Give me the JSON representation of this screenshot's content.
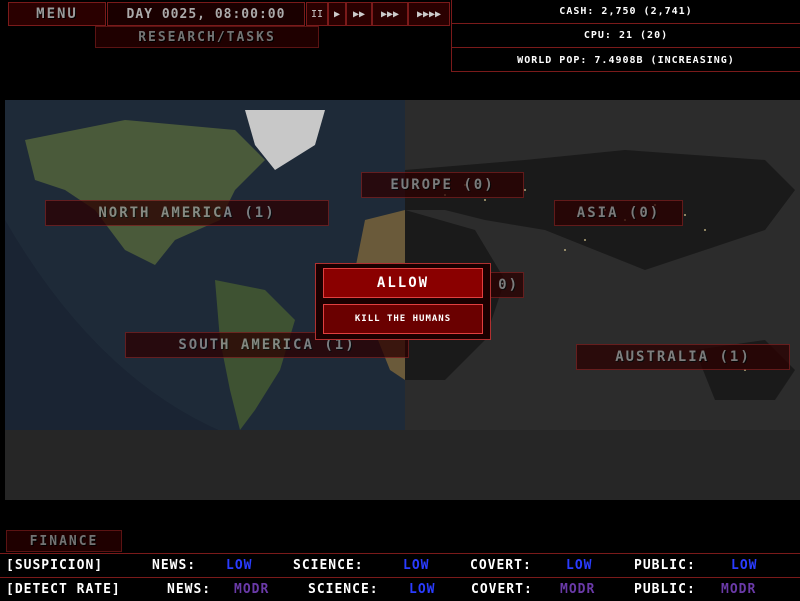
{
  "topbar": {
    "menu_label": "Menu",
    "day_text": "DAY 0025, 08:00:00",
    "speed_buttons": [
      "II",
      "▶",
      "▶▶",
      "▶▶▶",
      "▶▶▶▶"
    ],
    "research_label": "Research/Tasks"
  },
  "stats": {
    "cash": "CASH: 2,750 (2,741)",
    "cpu": "CPU: 21 (20)",
    "world_pop": "WORLD POP: 7.4908B (INCREASING)"
  },
  "regions": {
    "north_america": "NORTH AMERICA (1)",
    "south_america": "SOUTH AMERICA (1)",
    "europe": "EUROPE (0)",
    "asia": "ASIA (0)",
    "australia": "AUSTRALIA (1)",
    "africa_partial": "0)"
  },
  "dialog": {
    "allow_label": "Allow",
    "kill_label": "Kill the humans"
  },
  "finance_label": "Finance",
  "suspicion": {
    "label": "[SUSPICION]",
    "news_label": "NEWS:",
    "news_value": "LOW",
    "science_label": "SCIENCE:",
    "science_value": "LOW",
    "covert_label": "COVERT:",
    "covert_value": "LOW",
    "public_label": "PUBLIC:",
    "public_value": "LOW"
  },
  "detect_rate": {
    "label": "[DETECT RATE]",
    "news_label": "NEWS:",
    "news_value": "MODR",
    "science_label": "SCIENCE:",
    "science_value": "LOW",
    "covert_label": "COVERT:",
    "covert_value": "MODR",
    "public_label": "PUBLIC:",
    "public_value": "MODR"
  },
  "colors": {
    "accent": "#7a1a1a",
    "button_bg": "#2a0000",
    "low": "#2a3cff",
    "modr": "#6a3aa8"
  }
}
